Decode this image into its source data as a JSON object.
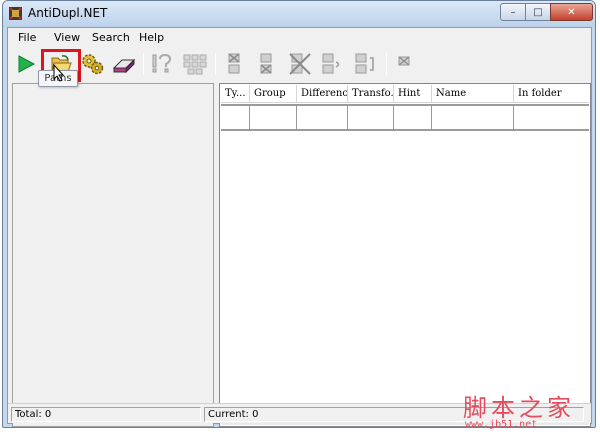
{
  "window": {
    "title": "AntiDupl.NET",
    "controls": {
      "minimize": "–",
      "maximize": "□",
      "close": "✕"
    }
  },
  "menu": [
    "File",
    "View",
    "Search",
    "Help"
  ],
  "toolbar": {
    "buttons": [
      {
        "name": "start-search",
        "icon": "play-icon",
        "enabled": true
      },
      {
        "name": "paths",
        "icon": "folder-open-icon",
        "enabled": true
      },
      {
        "name": "options",
        "icon": "gears-icon",
        "enabled": true
      },
      {
        "name": "clear-database",
        "icon": "eraser-icon",
        "enabled": true
      },
      {
        "name": "help",
        "icon": "help-icon",
        "enabled": false
      },
      {
        "name": "thumbnails",
        "icon": "grid-icon",
        "enabled": false
      },
      {
        "name": "delete-first",
        "icon": "delete-first-icon",
        "enabled": false
      },
      {
        "name": "delete-second",
        "icon": "delete-second-icon",
        "enabled": false
      },
      {
        "name": "delete-both",
        "icon": "delete-both-icon",
        "enabled": false
      },
      {
        "name": "mistake",
        "icon": "mistake-icon",
        "enabled": false
      },
      {
        "name": "rename",
        "icon": "rename-icon",
        "enabled": false
      },
      {
        "name": "undo",
        "icon": "undo-icon",
        "enabled": false
      }
    ],
    "highlight_color": "#e2141a"
  },
  "tooltip": "Paths",
  "grid": {
    "columns": [
      "Ty...",
      "Group",
      "Difference",
      "Transfo...",
      "Hint",
      "Name",
      "In folder"
    ]
  },
  "status": {
    "total": "Total: 0",
    "current": "Current: 0"
  },
  "watermark": {
    "chinese": "脚本之家",
    "url": "www.jb51.net",
    "color": "#e24e5e"
  }
}
